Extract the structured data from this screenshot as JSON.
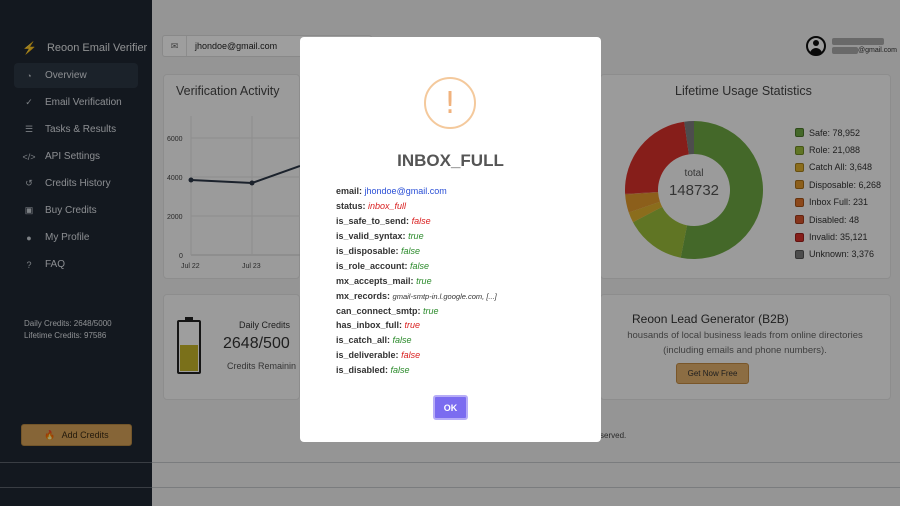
{
  "sidebar": {
    "brand": "Reoon Email Verifier",
    "items": [
      {
        "label": "Overview",
        "icon": "chart-pie-icon",
        "active": true
      },
      {
        "label": "Email Verification",
        "icon": "check-circle-icon"
      },
      {
        "label": "Tasks & Results",
        "icon": "list-icon"
      },
      {
        "label": "API Settings",
        "icon": "code-icon"
      },
      {
        "label": "Credits History",
        "icon": "history-icon"
      },
      {
        "label": "Buy Credits",
        "icon": "bag-icon"
      },
      {
        "label": "My Profile",
        "icon": "user-icon"
      },
      {
        "label": "FAQ",
        "icon": "help-icon"
      }
    ],
    "daily_credits": "Daily Credits: 2648/5000",
    "lifetime_credits": "Lifetime Credits: 97586",
    "add_credits": "Add Credits"
  },
  "header": {
    "search_value": "jhondoe@gmail.com",
    "user_email_suffix": "@gmail.com"
  },
  "activity": {
    "title": "Verification Activity",
    "y_ticks": [
      "6000",
      "4000",
      "2000",
      "0"
    ],
    "x_ticks": [
      "Jul 22",
      "Jul 23"
    ]
  },
  "lifetime": {
    "title": "Lifetime Usage Statistics",
    "total_label": "total",
    "total_value": "148732",
    "legend": [
      {
        "label": "Safe: 78,952",
        "color": "#6fa843"
      },
      {
        "label": "Role: 21,088",
        "color": "#9bbd3a"
      },
      {
        "label": "Catch All: 3,648",
        "color": "#e0b12e"
      },
      {
        "label": "Disposable: 6,268",
        "color": "#e39a2c"
      },
      {
        "label": "Inbox Full: 231",
        "color": "#e2742a"
      },
      {
        "label": "Disabled: 48",
        "color": "#d9542d"
      },
      {
        "label": "Invalid: 35,121",
        "color": "#d9312a"
      },
      {
        "label": "Unknown: 3,376",
        "color": "#7d7d7d"
      }
    ]
  },
  "daily": {
    "label": "Daily Credits",
    "value": "2648/500",
    "remaining": "Credits Remainin",
    "battery_level": 0.53
  },
  "lead": {
    "title": "Reoon Lead Generator (B2B)",
    "desc1": "housands of local business leads from online directories",
    "desc2": "(including emails and phone numbers).",
    "button": "Get Now Free"
  },
  "footer": {
    "reserved": "served."
  },
  "modal": {
    "icon": "!",
    "title": "INBOX_FULL",
    "fields": [
      {
        "key": "email:",
        "value": "jhondoe@gmail.com",
        "style": "email"
      },
      {
        "key": "status:",
        "value": "inbox_full",
        "style": "red"
      },
      {
        "key": "is_safe_to_send:",
        "value": "false",
        "style": "red"
      },
      {
        "key": "is_valid_syntax:",
        "value": "true",
        "style": "green"
      },
      {
        "key": "is_disposable:",
        "value": "false",
        "style": "green"
      },
      {
        "key": "is_role_account:",
        "value": "false",
        "style": "green"
      },
      {
        "key": "mx_accepts_mail:",
        "value": "true",
        "style": "green"
      },
      {
        "key": "mx_records:",
        "value": "gmail-smtp-in.l.google.com, [...]",
        "style": "dark"
      },
      {
        "key": "can_connect_smtp:",
        "value": "true",
        "style": "green"
      },
      {
        "key": "has_inbox_full:",
        "value": "true",
        "style": "red"
      },
      {
        "key": "is_catch_all:",
        "value": "false",
        "style": "green"
      },
      {
        "key": "is_deliverable:",
        "value": "false",
        "style": "red"
      },
      {
        "key": "is_disabled:",
        "value": "false",
        "style": "green"
      }
    ],
    "ok_label": "OK"
  }
}
